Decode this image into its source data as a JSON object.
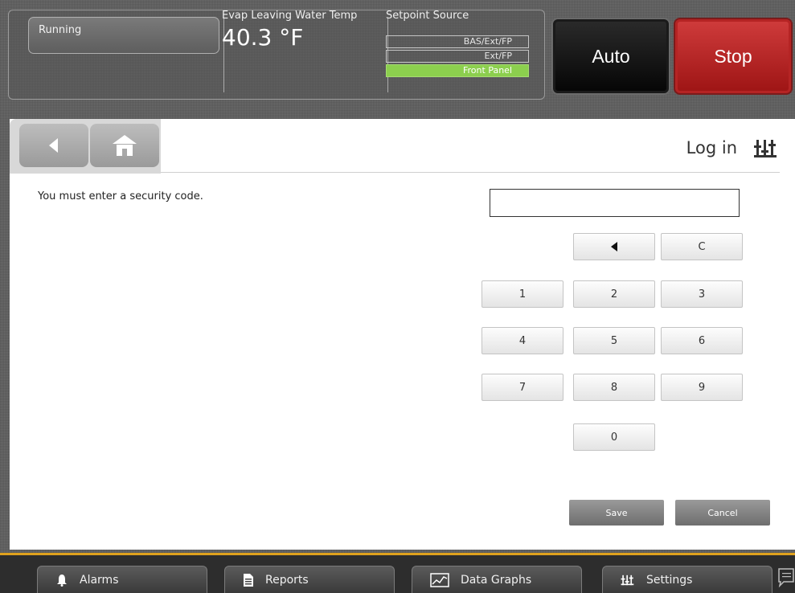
{
  "status": {
    "mode": "Running",
    "evap_label": "Evap Leaving Water Temp",
    "evap_value": "40.3 °F",
    "setpoint_label": "Setpoint Source",
    "setpoint_options": [
      "BAS/Ext/FP",
      "Ext/FP",
      "Front Panel"
    ],
    "setpoint_active": "Front Panel",
    "active_color": "#8ccf4e"
  },
  "controls": {
    "auto_label": "Auto",
    "stop_label": "Stop",
    "stop_color": "#c02828"
  },
  "nav": {
    "back_icon": "back-arrow-icon",
    "home_icon": "home-icon"
  },
  "page": {
    "title": "Log in",
    "title_icon": "settings-sliders-icon",
    "message": "You must enter a security code.",
    "code_value": ""
  },
  "keypad": {
    "backspace": "◀",
    "clear": "C",
    "digits": [
      "1",
      "2",
      "3",
      "4",
      "5",
      "6",
      "7",
      "8",
      "9",
      "0"
    ]
  },
  "actions": {
    "save": "Save",
    "cancel": "Cancel"
  },
  "bottom_nav": {
    "alarms": "Alarms",
    "reports": "Reports",
    "data_graphs": "Data Graphs",
    "settings": "Settings",
    "accent": "#e0a21e"
  }
}
